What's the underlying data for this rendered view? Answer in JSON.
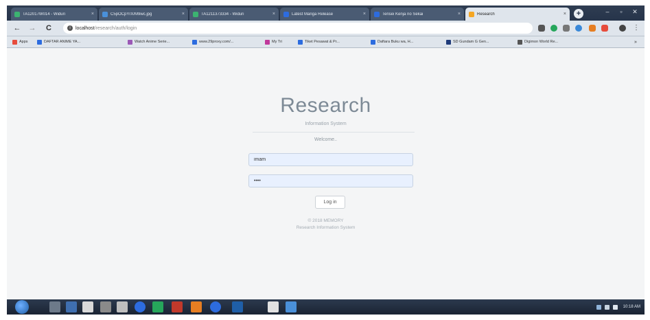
{
  "browser": {
    "tabs": [
      {
        "label": "TA12017W014 - Widuri",
        "icon_color": "#3cb371",
        "active": false
      },
      {
        "label": "C5pOCpYrX/M9wc.jpg",
        "icon_color": "#4a90d9",
        "active": false
      },
      {
        "label": "TA1211373334 - Widuri",
        "icon_color": "#3cb371",
        "active": false
      },
      {
        "label": "Latest Manga Release",
        "icon_color": "#2d6cdf",
        "active": false
      },
      {
        "label": "Tensei Kenja no Sekai",
        "icon_color": "#2d6cdf",
        "active": false
      },
      {
        "label": "Research",
        "icon_color": "#f5a623",
        "active": true
      }
    ],
    "tab_close_glyph": "×",
    "new_tab_glyph": "+",
    "window_controls": {
      "minimize": "–",
      "maximize": "▫",
      "close": "✕"
    },
    "nav": {
      "back": "←",
      "forward": "→",
      "reload": "C"
    },
    "url_host": "localhost",
    "url_path": "/research/auth/login",
    "bookmarks": [
      {
        "label": "Apps",
        "icon_color": "#e74c3c"
      },
      {
        "label": "DAFTAR ANIME YA...",
        "icon_color": "#2d6cdf"
      },
      {
        "label": "Watch Anime Serie...",
        "icon_color": "#9b59b6"
      },
      {
        "label": "www.29proxy.com/...",
        "icon_color": "#2d6cdf"
      },
      {
        "label": "My Tri",
        "icon_color": "#c0399b"
      },
      {
        "label": "Tiket Pesawat & Pr...",
        "icon_color": "#2d6cdf"
      },
      {
        "label": "Daftara Buku wa, H...",
        "icon_color": "#2d6cdf"
      },
      {
        "label": "SD Gundam G Gen...",
        "icon_color": "#1f3b7a"
      },
      {
        "label": "Digimon World Re...",
        "icon_color": "#555555"
      }
    ],
    "extension_colors": [
      "#555555",
      "#26a65b",
      "#777777",
      "#3a88d8",
      "#e67e22",
      "#e74c3c",
      "#444444"
    ]
  },
  "login": {
    "title": "Research",
    "subtitle": "Information System",
    "welcome": "Welcome..",
    "username_value": "imam",
    "password_value": "••••",
    "login_label": "Log in",
    "copyright": "© 2018 MEMORY",
    "footer_system": "Research Information System"
  },
  "taskbar": {
    "app_colors": [
      "#6d7a8a",
      "#3f6fb0",
      "#d9d9d9",
      "#8a8a8a",
      "#bfbfbf",
      "#2d6cdf",
      "#26a65b",
      "#c0392b",
      "#e67e22",
      "#2d6cdf",
      "#1f5fa8",
      "#e1e1e1",
      "#4a90d9"
    ],
    "clock": "10:18 AM"
  }
}
